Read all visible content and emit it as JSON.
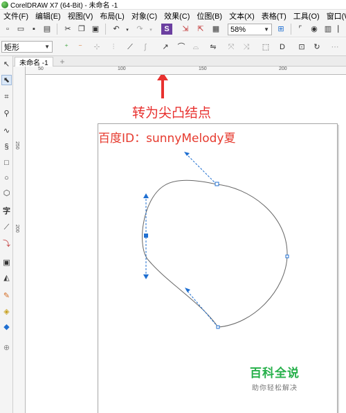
{
  "window": {
    "title": "CorelDRAW X7 (64-Bit) - 未命名 -1"
  },
  "menu": [
    "文件(F)",
    "编辑(E)",
    "视图(V)",
    "布局(L)",
    "对象(C)",
    "效果(C)",
    "位图(B)",
    "文本(X)",
    "表格(T)",
    "工具(O)",
    "窗口(W)"
  ],
  "toolbar": {
    "zoom": "58%"
  },
  "property_bar": {
    "shape_type": "矩形"
  },
  "document_tab": {
    "label": "未命名 -1",
    "add_label": "+"
  },
  "rulers": {
    "top": [
      "50",
      "100",
      "150",
      "200"
    ],
    "left": [
      "250",
      "200"
    ]
  },
  "annotation": {
    "text": "转为尖凸结点"
  },
  "canvas_text": {
    "watermark": "百度ID：sunnyMelody夏"
  },
  "brand": {
    "name": "百科全说",
    "slogan": "助你轻松解决"
  },
  "colors": {
    "accent": "#e8312f",
    "brand_green": "#26b04a",
    "handle_blue": "#1f6fd1"
  }
}
